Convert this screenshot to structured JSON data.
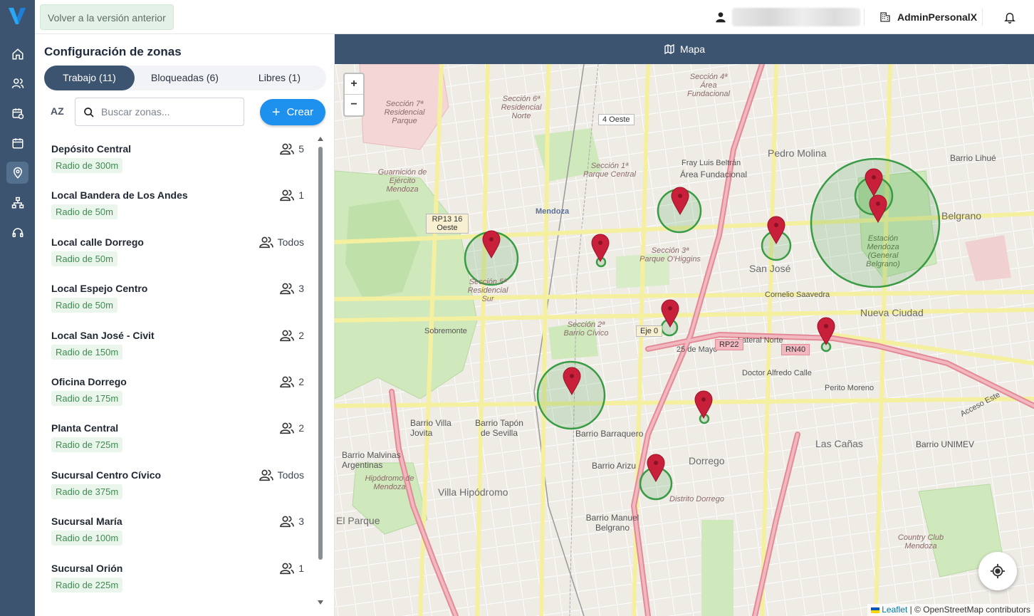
{
  "topbar": {
    "back_button": "Volver a la versión anterior",
    "company": "AdminPersonalX"
  },
  "panel": {
    "title": "Configuración de zonas",
    "tabs": [
      {
        "label": "Trabajo (11)",
        "active": true
      },
      {
        "label": "Bloqueadas (6)",
        "active": false
      },
      {
        "label": "Libres (1)",
        "active": false
      }
    ],
    "sort_label": "AZ",
    "search_placeholder": "Buscar zonas...",
    "create_button": "Crear",
    "zones": [
      {
        "name": "Depósito Central",
        "radius": "Radio de 300m",
        "count": "5"
      },
      {
        "name": "Local Bandera de Los Andes",
        "radius": "Radio de 50m",
        "count": "1"
      },
      {
        "name": "Local calle Dorrego",
        "radius": "Radio de 50m",
        "count": "Todos"
      },
      {
        "name": "Local Espejo Centro",
        "radius": "Radio de 50m",
        "count": "3"
      },
      {
        "name": "Local San José - Civit",
        "radius": "Radio de 150m",
        "count": "2"
      },
      {
        "name": "Oficina Dorrego",
        "radius": "Radio de 175m",
        "count": "2"
      },
      {
        "name": "Planta Central",
        "radius": "Radio de 725m",
        "count": "2"
      },
      {
        "name": "Sucursal Centro Cívico",
        "radius": "Radio de 375m",
        "count": "Todos"
      },
      {
        "name": "Sucursal María",
        "radius": "Radio de 100m",
        "count": "3"
      },
      {
        "name": "Sucursal Orión",
        "radius": "Radio de 225m",
        "count": "1"
      }
    ]
  },
  "map": {
    "header": "Mapa",
    "zoom_in": "+",
    "zoom_out": "−",
    "attribution_leaflet": "Leaflet",
    "attribution_osm": "| © OpenStreetMap contributors",
    "labels": {
      "mendoza": "Mendoza",
      "pedro_molina": "Pedro Molina",
      "belgrano": "Belgrano",
      "san_jose": "San José",
      "nueva_ciudad": "Nueva Ciudad",
      "las_canas": "Las Cañas",
      "dorrego": "Dorrego",
      "villa_hipodromo": "Villa Hipódromo",
      "barrio_barraquero": "Barrio Barraquero",
      "area_fundacional": "Área Fundacional",
      "el_parque": "El Parque",
      "barrio_villa_jovita": "Barrio Villa Jovita",
      "barrio_tapon": "Barrio Tapón de Sevilla",
      "barrio_malvinas": "Barrio Malvinas Argentinas",
      "barrio_arizu": "Barrio Arizu",
      "barrio_manuel_belgrano": "Barrio Manuel Belgrano",
      "barrio_unimev": "Barrio UNIMEV",
      "barrio_lihue": "Barrio Lihué",
      "seccion_3": "Sección 3ª Parque O'Higgins",
      "seccion_2": "Sección 2ª Barrio Cívico",
      "seccion_5": "Sección 5ª Residencial Sur",
      "seccion_1": "Sección 1ª Parque Central",
      "seccion_6": "Sección 6ª Residencial Norte",
      "seccion_7": "Sección 7ª Residencial Parque",
      "seccion_4": "Sección 4ª Área Fundacional",
      "distrito_dorrego": "Distrito Dorrego",
      "hipodromo": "Hipódromo de Mendoza",
      "country_club": "Country Club Mendoza",
      "estacion": "Estación Mendoza (General Belgrano)",
      "guarnicion": "Guarnición de Ejército Mendoza",
      "fray_luis": "Fray Luis Beltrán",
      "sobremonte": "Sobremonte",
      "cornelio": "Cornelio Saavedra",
      "doctor_alfredo": "Doctor Alfredo Calle",
      "perito_moreno": "Perito Moreno",
      "acceso_este": "Acceso Este",
      "lateral_norte": "Lateral Norte",
      "25_mayo": "25 de Mayo",
      "rp22": "RP22",
      "rn40": "RN40",
      "rp13": "RP13 16 Oeste",
      "4_oeste": "4 Oeste",
      "eje_0": "Eje 0"
    }
  },
  "colors": {
    "sidebar": "#3d5470",
    "accent": "#1e90ee",
    "zone_green": "#3a9b45",
    "marker_red": "#c8203a"
  },
  "icons": {
    "logo": "v-logo-icon",
    "user": "user-icon",
    "building": "building-icon",
    "bell": "bell-icon",
    "search": "search-icon",
    "people": "people-icon",
    "map": "map-icon",
    "locate": "locate-icon"
  }
}
